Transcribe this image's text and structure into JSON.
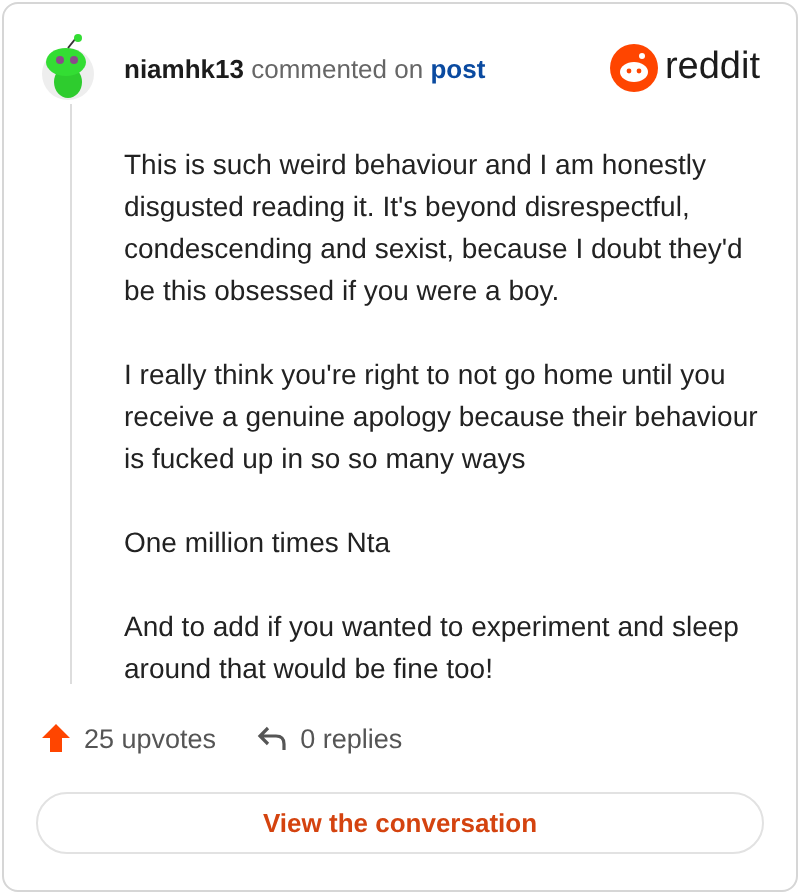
{
  "header": {
    "username": "niamhk13",
    "action": "commented on",
    "link": "post",
    "brand": "reddit"
  },
  "paragraphs": [
    "This is such weird behaviour and I am honestly disgusted reading it. It's beyond disrespectful, condescending and sexist, because I doubt they'd be this obsessed if you were a boy.",
    "I really think you're right to not go home until you receive a genuine apology because their behaviour is fucked up in so so many ways",
    "One million times Nta",
    "And to add if you wanted to experiment and sleep around that would be fine too!"
  ],
  "footer": {
    "upvotes": "25 upvotes",
    "replies": "0 replies"
  },
  "button": "View the conversation"
}
